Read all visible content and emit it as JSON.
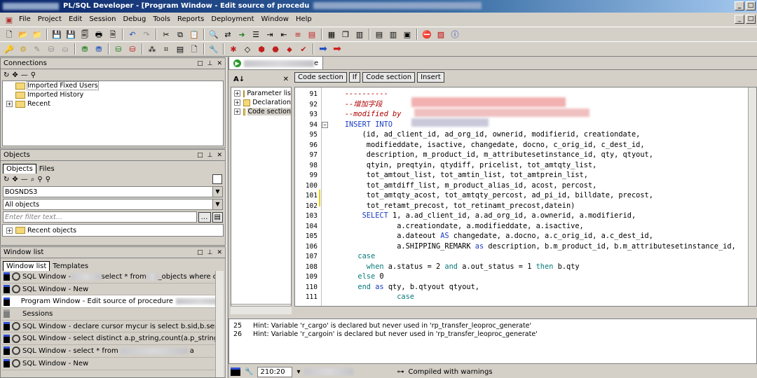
{
  "title": {
    "text": "PL/SQL Developer - [Program Window - Edit source of procedu"
  },
  "menu": [
    "File",
    "Project",
    "Edit",
    "Session",
    "Debug",
    "Tools",
    "Reports",
    "Deployment",
    "Window",
    "Help"
  ],
  "connections": {
    "title": "Connections",
    "items": [
      "Imported Fixed Users",
      "Imported History",
      "Recent"
    ]
  },
  "objects": {
    "title": "Objects",
    "tabs": [
      "Objects",
      "Files"
    ],
    "schema": "BOSNDS3",
    "filter_type": "All objects",
    "filter_placeholder": "Enter filter text...",
    "tree_item": "Recent objects"
  },
  "windowlist": {
    "title": "Window list",
    "tabs": [
      "Window list",
      "Templates"
    ],
    "rows": [
      {
        "label": "SQL Window - ",
        "label2": "select * from",
        "label3": "_objects where obj",
        "kind": "sql"
      },
      {
        "label": "SQL Window - New",
        "kind": "sql"
      },
      {
        "label": "Program Window - Edit source of procedure",
        "kind": "prog",
        "selected": true
      },
      {
        "label": "Sessions",
        "kind": "sess"
      },
      {
        "label": "SQL Window - declare cursor mycur is select b.sid,b.serial#",
        "label3": "fr",
        "kind": "sql"
      },
      {
        "label": "SQL Window - select distinct a.p_string,count(a.p_string) from AD",
        "kind": "sql"
      },
      {
        "label": "SQL Window - select * from",
        "label3": "a",
        "kind": "sql"
      },
      {
        "label": "SQL Window - New",
        "kind": "sql"
      }
    ]
  },
  "editor": {
    "tab_suffix": "e",
    "section_buttons": [
      "Code section",
      "If",
      "Code section",
      "Insert"
    ],
    "nav": [
      "Parameter lis",
      "Declaration",
      "Code section"
    ],
    "lines": [
      {
        "n": "91",
        "html": "    <span class='cm'>----------</span>"
      },
      {
        "n": "92",
        "html": "    <span class='cm'>--增加字段</span>"
      },
      {
        "n": "93",
        "html": "    <span class='cm'>--modified by</span>"
      },
      {
        "n": "94",
        "html": "    <span class='kw'>INSERT INTO</span>",
        "fold": true
      },
      {
        "n": "95",
        "html": "        (id, ad_client_id, ad_org_id, ownerid, modifierid, creationdate,"
      },
      {
        "n": "96",
        "html": "         modifieddate, isactive, changedate, docno, c_orig_id, c_dest_id,"
      },
      {
        "n": "97",
        "html": "         description, m_product_id, m_attributesetinstance_id, qty, qtyout,"
      },
      {
        "n": "98",
        "html": "         qtyin, preqtyin, qtydiff, pricelist, tot_amtqty_list,"
      },
      {
        "n": "99",
        "html": "         tot_amtout_list, tot_amtin_list, tot_amtprein_list,"
      },
      {
        "n": "100",
        "html": "         tot_amtdiff_list, m_product_alias_id, acost, percost,"
      },
      {
        "n": "101",
        "html": "         tot_amtqty_acost, tot_amtqty_percost, ad_pi_id, billdate, precost,"
      },
      {
        "n": "102",
        "html": "         tot_retamt_precost, tot_retinamt_precost,datein)"
      },
      {
        "n": "103",
        "html": "        <span class='kw'>SELECT</span> 1, a.ad_client_id, a.ad_org_id, a.ownerid, a.modifierid,"
      },
      {
        "n": "104",
        "html": "                a.creationdate, a.modifieddate, a.isactive,"
      },
      {
        "n": "105",
        "html": "                a.dateout <span class='kw'>AS</span> changedate, a.docno, a.c_orig_id, a.c_dest_id,"
      },
      {
        "n": "106",
        "html": "                a.SHIPPING_REMARK <span class='kw'>as</span> description, b.m_product_id, b.m_attributesetinstance_id,"
      },
      {
        "n": "107",
        "html": "       <span class='op'>case</span>"
      },
      {
        "n": "108",
        "html": "         <span class='op'>when</span> a.status = 2 <span class='op'>and</span> a.out_status = 1 <span class='op'>then</span> b.qty"
      },
      {
        "n": "109",
        "html": "       <span class='op'>else</span> 0"
      },
      {
        "n": "110",
        "html": "       <span class='op'>end</span> <span class='kw'>as</span> qty, b.qtyout qtyout,"
      },
      {
        "n": "111",
        "html": "                <span class='op'>case</span>"
      }
    ]
  },
  "hints": [
    {
      "n": "25",
      "text": "Hint: Variable 'r_cargo' is declared but never used in 'rp_transfer_leoproc_generate'"
    },
    {
      "n": "26",
      "text": "Hint: Variable 'r_cargoin' is declared but never used in 'rp_transfer_leoproc_generate'"
    }
  ],
  "status": {
    "pos": "210:20",
    "msg": "Compiled with warnings"
  },
  "colors": {
    "title_bar": "#0a246a",
    "chrome": "#d4d0c8",
    "keyword": "#1a3cc0",
    "comment": "#b00000"
  }
}
